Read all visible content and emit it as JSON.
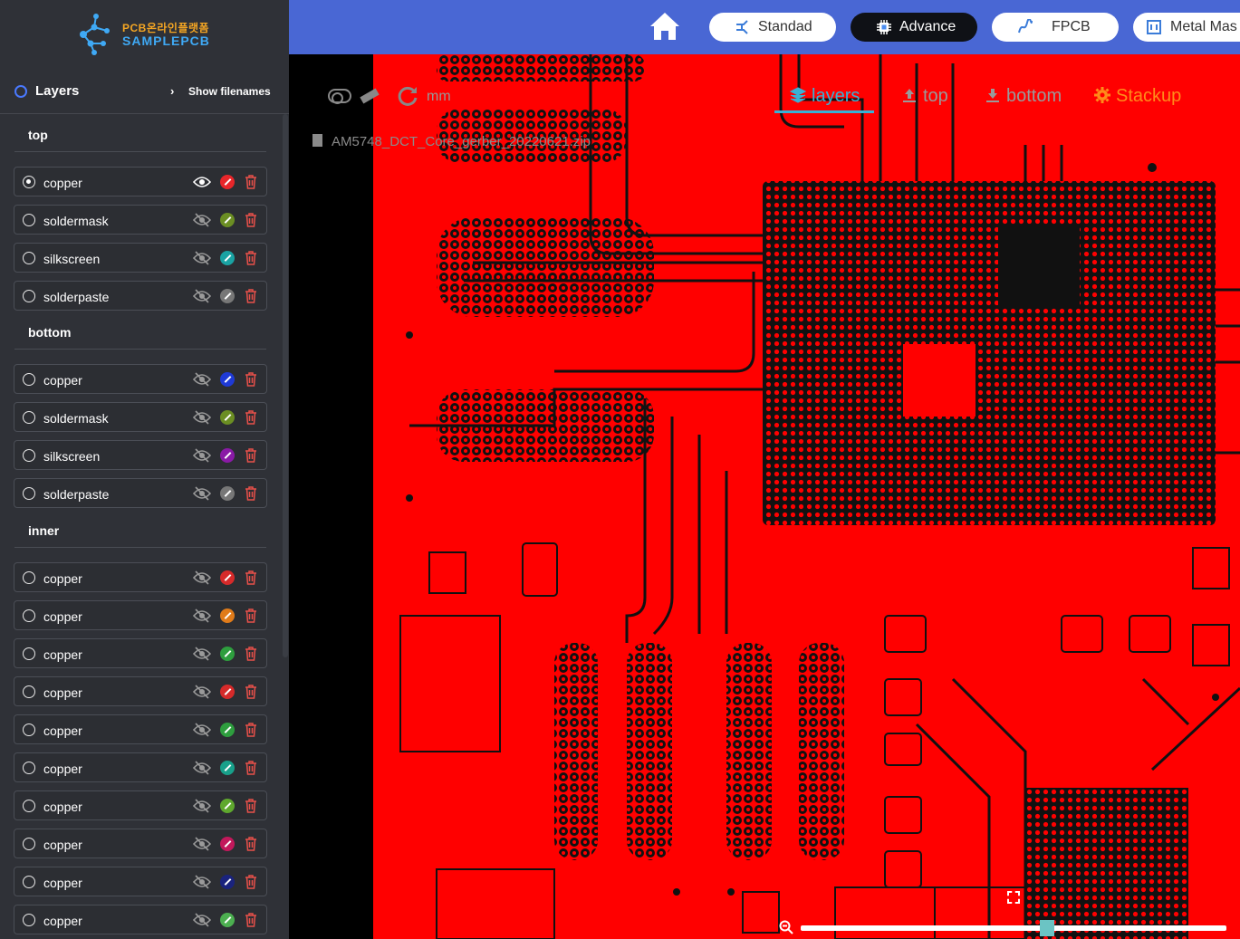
{
  "brand": {
    "line1": "PCB온라인플랫폼",
    "line2": "SAMPLEPCB"
  },
  "sidebar": {
    "title": "Layers",
    "show_filenames": "Show filenames",
    "sections": [
      {
        "label": "top",
        "layers": [
          {
            "name": "copper",
            "selected": true,
            "visible": true,
            "color": "#e8262a"
          },
          {
            "name": "soldermask",
            "selected": false,
            "visible": false,
            "color": "#6b8e23"
          },
          {
            "name": "silkscreen",
            "selected": false,
            "visible": false,
            "color": "#1aa3a3"
          },
          {
            "name": "solderpaste",
            "selected": false,
            "visible": false,
            "color": "#777777"
          }
        ]
      },
      {
        "label": "bottom",
        "layers": [
          {
            "name": "copper",
            "selected": false,
            "visible": false,
            "color": "#1f3ad6"
          },
          {
            "name": "soldermask",
            "selected": false,
            "visible": false,
            "color": "#6b8e23"
          },
          {
            "name": "silkscreen",
            "selected": false,
            "visible": false,
            "color": "#8a1aa6"
          },
          {
            "name": "solderpaste",
            "selected": false,
            "visible": false,
            "color": "#777777"
          }
        ]
      },
      {
        "label": "inner",
        "layers": [
          {
            "name": "copper",
            "selected": false,
            "visible": false,
            "color": "#d62a2a"
          },
          {
            "name": "copper",
            "selected": false,
            "visible": false,
            "color": "#e07b1a"
          },
          {
            "name": "copper",
            "selected": false,
            "visible": false,
            "color": "#2e9e3e"
          },
          {
            "name": "copper",
            "selected": false,
            "visible": false,
            "color": "#d62a2a"
          },
          {
            "name": "copper",
            "selected": false,
            "visible": false,
            "color": "#2e9e3e"
          },
          {
            "name": "copper",
            "selected": false,
            "visible": false,
            "color": "#18a08a"
          },
          {
            "name": "copper",
            "selected": false,
            "visible": false,
            "color": "#5fa82e"
          },
          {
            "name": "copper",
            "selected": false,
            "visible": false,
            "color": "#c2185b"
          },
          {
            "name": "copper",
            "selected": false,
            "visible": false,
            "color": "#1a237e"
          },
          {
            "name": "copper",
            "selected": false,
            "visible": false,
            "color": "#4caf50"
          }
        ]
      }
    ]
  },
  "topbar": {
    "buttons": [
      {
        "label": "Standad",
        "active": false
      },
      {
        "label": "Advance",
        "active": true
      },
      {
        "label": "FPCB",
        "active": false
      },
      {
        "label": "Metal Mas",
        "active": false
      }
    ]
  },
  "viewer": {
    "units": "mm",
    "tabs": {
      "layers": "layers",
      "top": "top",
      "bottom": "bottom",
      "stackup": "Stackup"
    },
    "filename": "AM5748_DCT_Core_gerber_20220621.zip"
  },
  "colors": {
    "board": "#ff0000",
    "copper": "#111111",
    "accent": "#38b2d6",
    "topbar": "#4967d4"
  }
}
